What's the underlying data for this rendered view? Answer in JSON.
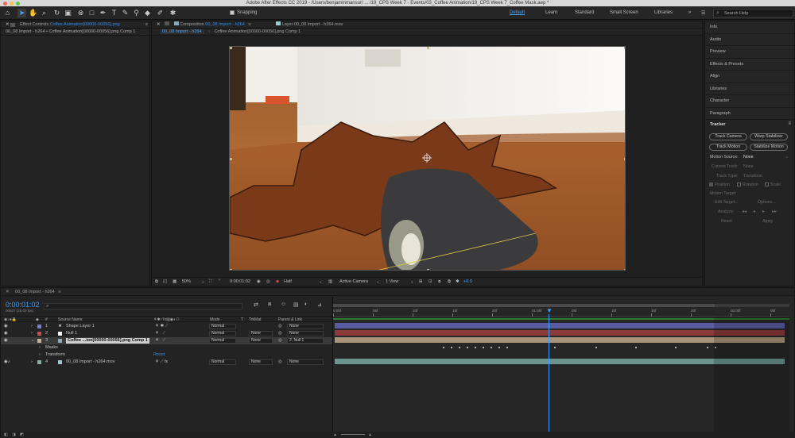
{
  "window": {
    "title": "Adobe After Effects CC 2019 - /Users/benjaminmansur/ ... /19_CPS Week 7 - Events/03_Coffee Animation/19_CPS Week 7_Coffee Mask.aep *"
  },
  "toolbar": {
    "snapping_label": "Snapping",
    "workspaces": [
      "Default",
      "Learn",
      "Standard",
      "Small Screen",
      "Libraries"
    ],
    "search_placeholder": "Search Help"
  },
  "effect_controls": {
    "tab_prefix": "Effect Controls",
    "tab_layer": "Coffee Animation[00000-00056].png",
    "breadcrumb": "00_08 Import - h264 • Coffee Animation[00000-00056].png Comp 1"
  },
  "composition": {
    "tab_prefix": "Composition",
    "tab_comp": "00_08 Import - h264",
    "layer_tab": "Layer 00_08 Import - h264.mov",
    "crumb_1": "00_08 Import - h264",
    "crumb_2": "Coffee Animation[00000-00056].png Comp 1",
    "footer": {
      "zoom": "50%",
      "timecode": "0:00:01:02",
      "resolution": "Half",
      "camera": "Active Camera",
      "view": "1 View",
      "exposure": "+0.0"
    }
  },
  "right_panel": {
    "items": [
      "Info",
      "Audio",
      "Preview",
      "Effects & Presets",
      "Align",
      "Libraries",
      "Character",
      "Paragraph"
    ],
    "tracker": {
      "title": "Tracker",
      "buttons": [
        "Track Camera",
        "Warp Stabilizer",
        "Track Motion",
        "Stabilize Motion"
      ],
      "motion_source_label": "Motion Source:",
      "motion_source_value": "None",
      "current_track_label": "Current Track:",
      "current_track_value": "None",
      "track_type_label": "Track Type:",
      "track_type_value": "Transform",
      "position_label": "Position",
      "rotation_label": "Rotation",
      "scale_label": "Scale",
      "motion_target_label": "Motion Target:",
      "edit_target": "Edit Target...",
      "options": "Options...",
      "analyze_label": "Analyze:",
      "reset": "Reset",
      "apply": "Apply"
    }
  },
  "timeline": {
    "tab": "00_08 Import - h264",
    "timecode": "0:00:01:02",
    "frames": "00027 (25.00 fps)",
    "search_placeholder": "",
    "columns": {
      "num": "#",
      "source_name": "Source Name",
      "mode": "Mode",
      "t": "T",
      "trkmat": "TrkMat",
      "parent": "Parent & Link"
    },
    "ruler_labels": [
      "0:00f",
      "05f",
      "10f",
      "15f",
      "20f",
      "01:00f",
      "05f",
      "10f",
      "15f",
      "20f",
      "02:00f",
      "05f"
    ],
    "layers": [
      {
        "num": "1",
        "name": "Shape Layer 1",
        "mode": "Normal",
        "trkmat": "",
        "parent": "None",
        "color": "#7a7ad0"
      },
      {
        "num": "2",
        "name": "Null 1",
        "mode": "Normal",
        "trkmat": "None",
        "parent": "None",
        "color": "#d04a4a"
      },
      {
        "num": "3",
        "name": "Coffee ...ion[00000-00056].png Comp 1",
        "mode": "Normal",
        "trkmat": "None",
        "parent": "2. Null 1",
        "color": "#c9b095"
      },
      {
        "num": "4",
        "name": "00_08 Import - h264.mov",
        "mode": "Normal",
        "trkmat": "None",
        "parent": "None",
        "color": "#7fb1a6"
      }
    ],
    "sub_masks": "Masks",
    "sub_transform": "Transform",
    "sub_reset": "Reset"
  }
}
